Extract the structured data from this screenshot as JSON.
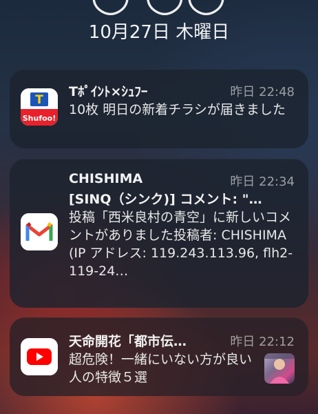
{
  "lockscreen": {
    "date": "10月27日 木曜日"
  },
  "notifications": [
    {
      "app_icon": "shufoo-icon",
      "title": "Tﾎﾟｲﾝﾄ×ｼｭﾌｰ",
      "time": "昨日 22:48",
      "body": "10枚 明日の新着チラシが届きました",
      "icon_text_top": "T",
      "icon_text_bottom": "Shufoo!"
    },
    {
      "app_icon": "gmail-icon",
      "title": "CHISHIMA",
      "subtitle": "[SINQ（シンク)] コメント: \"…",
      "time": "昨日 22:34",
      "body": "投稿「西米良村の青空」に新しいコメントがありました投稿者: CHISHIMA (IP アドレス: 119.243.113.96, flh2-119-24…"
    },
    {
      "app_icon": "youtube-icon",
      "title": "天命開花「都市伝…",
      "time": "昨日 22:12",
      "body": "超危険！一緒にいない方が良い人の特徴５選",
      "thumbnail": "video-thumbnail"
    }
  ]
}
